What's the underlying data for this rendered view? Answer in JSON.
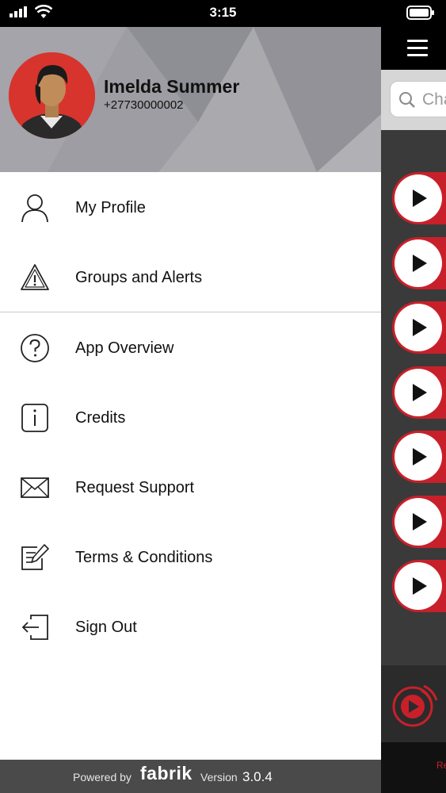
{
  "status_bar": {
    "time": "3:15",
    "signal_icon": "cellular-signal-icon",
    "wifi_icon": "wifi-icon",
    "battery_icon": "battery-icon"
  },
  "profile": {
    "name": "Imelda Summer",
    "phone": "+27730000002",
    "avatar_bg": "#d7342e"
  },
  "menu": {
    "items": [
      {
        "label": "My Profile",
        "icon": "user-icon"
      },
      {
        "label": "Groups and Alerts",
        "icon": "warning-icon"
      },
      {
        "label": "App Overview",
        "icon": "help-icon"
      },
      {
        "label": "Credits",
        "icon": "info-icon"
      },
      {
        "label": "Request Support",
        "icon": "mail-icon"
      },
      {
        "label": "Terms & Conditions",
        "icon": "edit-document-icon"
      },
      {
        "label": "Sign Out",
        "icon": "sign-out-icon"
      }
    ]
  },
  "footer": {
    "powered_by": "Powered by",
    "brand": "fabrik",
    "version_label": "Version",
    "version": "3.0.4"
  },
  "background_app": {
    "search_placeholder": "Cha",
    "bottom_label": "Re",
    "accent": "#c8202a"
  }
}
